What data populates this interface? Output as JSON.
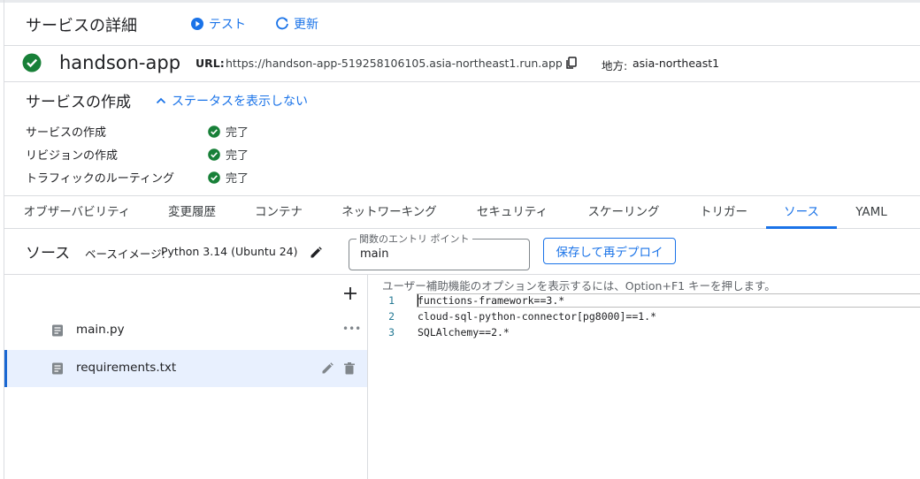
{
  "header": {
    "title": "サービスの詳細",
    "test_label": "テスト",
    "refresh_label": "更新"
  },
  "service": {
    "name": "handson-app",
    "url_label": "URL:",
    "url": "https://handson-app-519258106105.asia-northeast1.run.app",
    "region_label": "地方:",
    "region": "asia-northeast1",
    "status_color": "#188038"
  },
  "creation": {
    "title": "サービスの作成",
    "toggle_label": "ステータスを表示しない",
    "steps": [
      {
        "label": "サービスの作成",
        "status": "完了"
      },
      {
        "label": "リビジョンの作成",
        "status": "完了"
      },
      {
        "label": "トラフィックのルーティング",
        "status": "完了"
      }
    ]
  },
  "tabs": [
    {
      "label": "オブザーバビリティ",
      "active": false
    },
    {
      "label": "変更履歴",
      "active": false
    },
    {
      "label": "コンテナ",
      "active": false
    },
    {
      "label": "ネットワーキング",
      "active": false
    },
    {
      "label": "セキュリティ",
      "active": false
    },
    {
      "label": "スケーリング",
      "active": false
    },
    {
      "label": "トリガー",
      "active": false
    },
    {
      "label": "ソース",
      "active": true
    },
    {
      "label": "YAML",
      "active": false
    }
  ],
  "source": {
    "title": "ソース",
    "base_image_label": "ベースイメージ:",
    "base_image_value": "Python 3.14 (Ubuntu 24)",
    "entry_point_label": "関数のエントリ ポイント",
    "entry_point_value": "main",
    "redeploy_label": "保存して再デプロイ"
  },
  "files": [
    {
      "name": "main.py",
      "selected": false,
      "icon": "file-icon"
    },
    {
      "name": "requirements.txt",
      "selected": true,
      "icon": "file-icon"
    }
  ],
  "editor": {
    "hint": "ユーザー補助機能のオプションを表示するには、Option+F1 キーを押します。",
    "lines": [
      {
        "no": "1",
        "text": "functions-framework==3.*"
      },
      {
        "no": "2",
        "text": "cloud-sql-python-connector[pg8000]==1.*"
      },
      {
        "no": "3",
        "text": "SQLAlchemy==2.*"
      }
    ]
  },
  "colors": {
    "accent": "#1a73e8",
    "success": "#188038"
  }
}
